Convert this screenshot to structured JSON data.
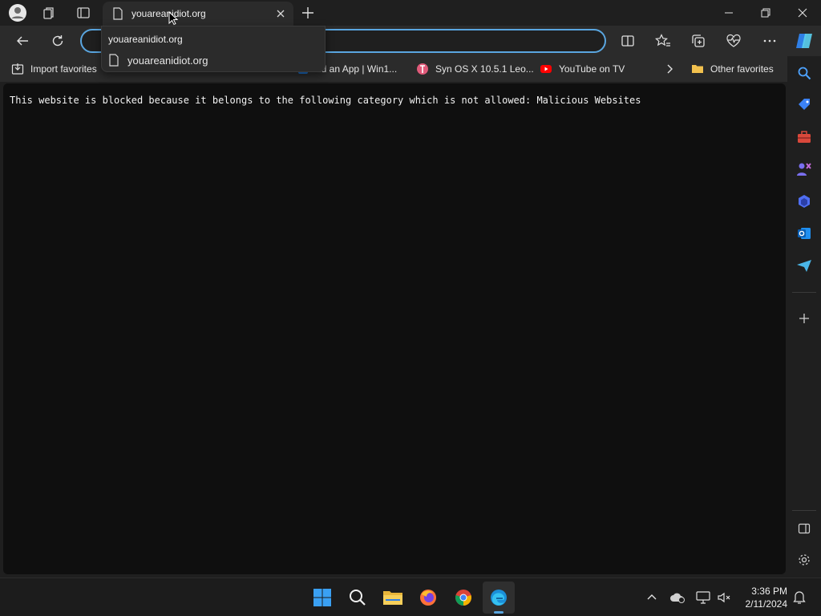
{
  "tab": {
    "title": "youareanidiot.org"
  },
  "suggestion": {
    "header": "youareanidiot.org",
    "item": "youareanidiot.org"
  },
  "favorites": [
    {
      "label": "Import favorites",
      "icon": "import-icon"
    },
    {
      "label": "dd an App | Win1...",
      "icon": "app-icon"
    },
    {
      "label": "Syn OS X 10.5.1 Leo...",
      "icon": "tux-icon"
    },
    {
      "label": "YouTube on TV",
      "icon": "youtube-icon"
    },
    {
      "label": "Other favorites",
      "icon": "folder-icon"
    }
  ],
  "page": {
    "message": "This website is blocked because it belongs to the following category which is not allowed: Malicious Websites"
  },
  "clock": {
    "time": "3:36 PM",
    "date": "2/11/2024"
  },
  "colors": {
    "accent": "#5aa6e0",
    "content_bg": "#0f0f0f",
    "chrome": "#2b2b2b"
  }
}
